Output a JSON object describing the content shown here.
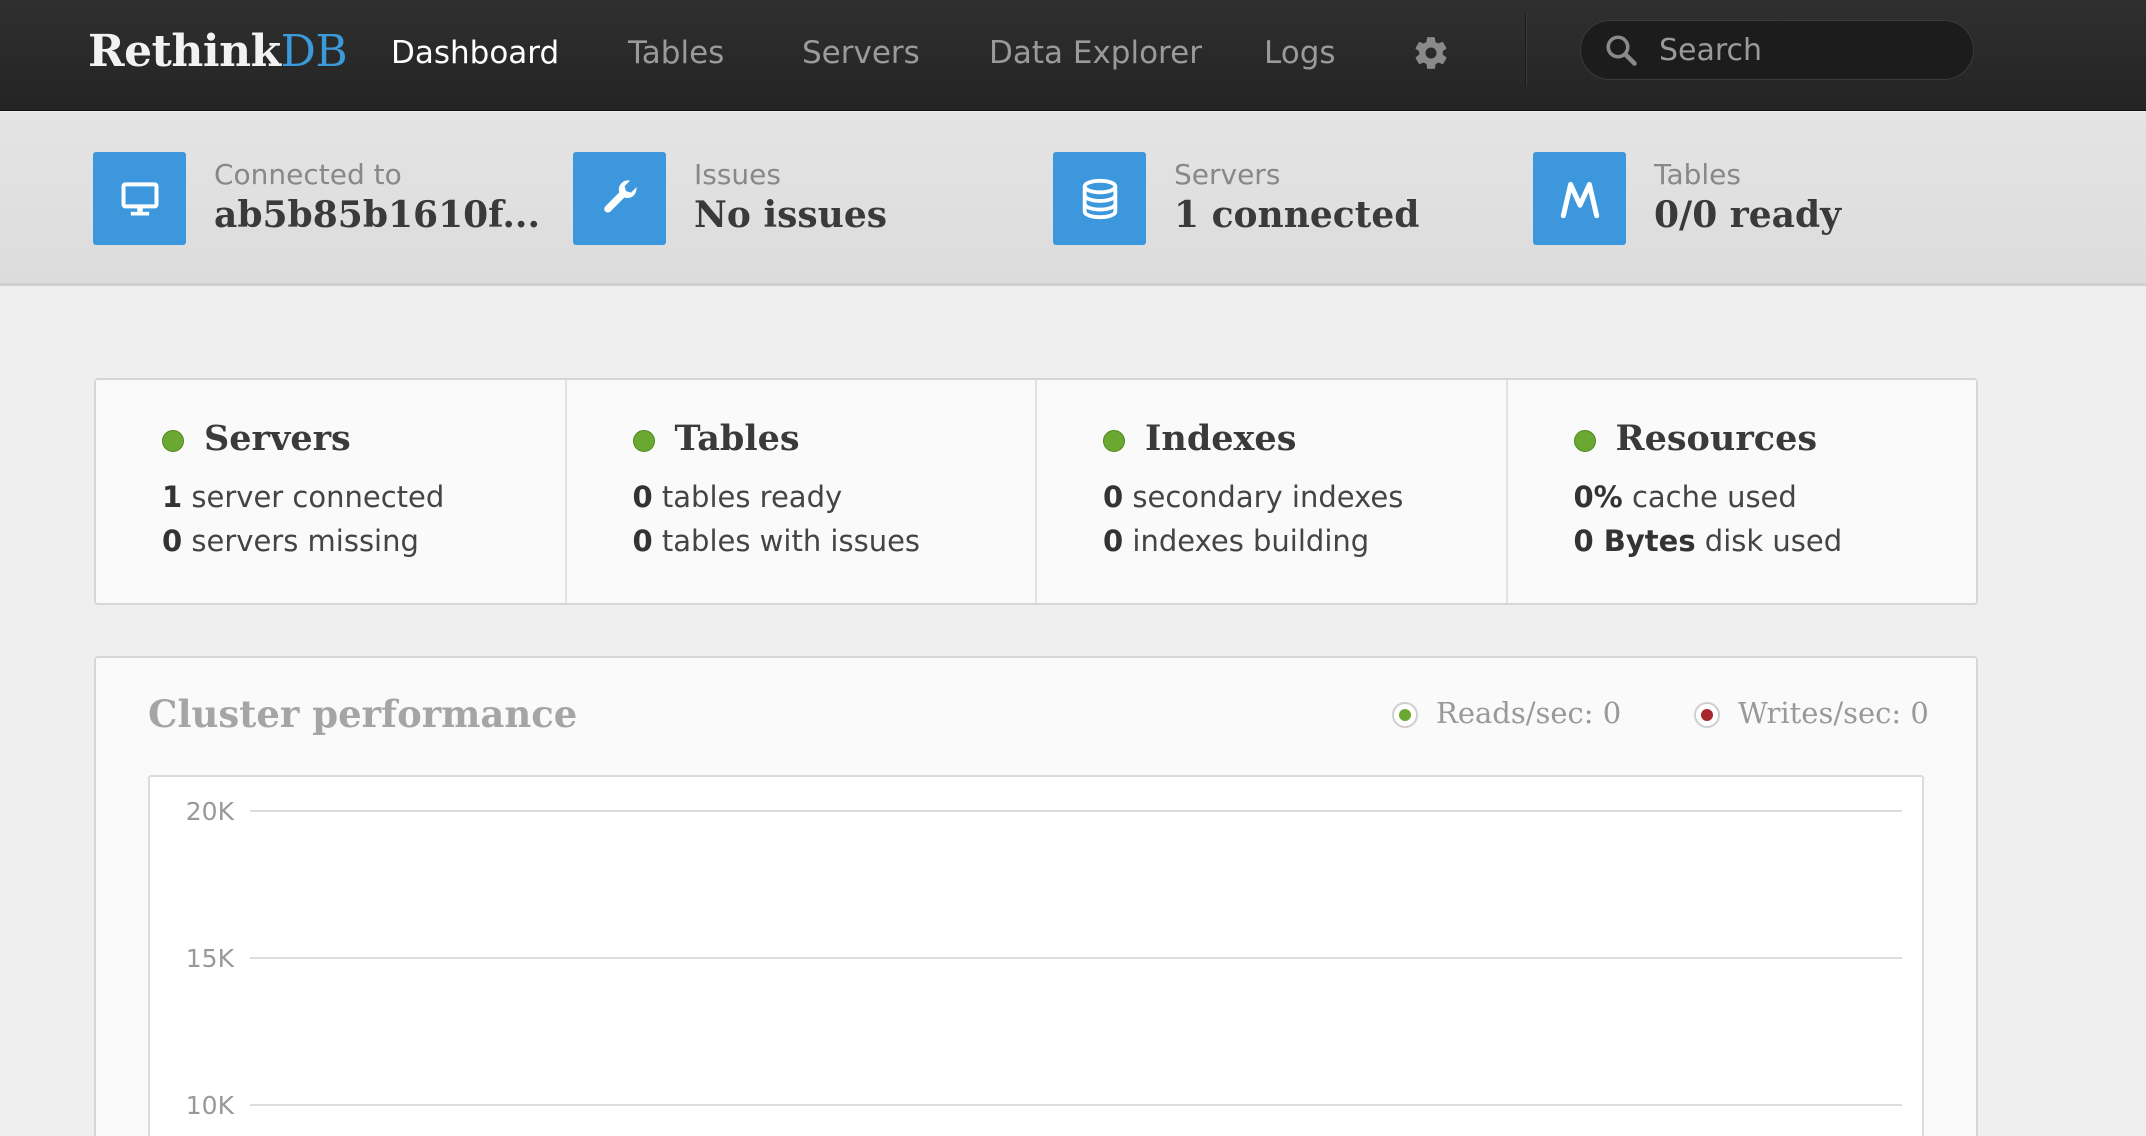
{
  "navbar": {
    "brand_main": "Rethink",
    "brand_accent": "DB",
    "items": [
      {
        "label": "Dashboard",
        "active": true
      },
      {
        "label": "Tables",
        "active": false
      },
      {
        "label": "Servers",
        "active": false
      },
      {
        "label": "Data Explorer",
        "active": false
      },
      {
        "label": "Logs",
        "active": false
      }
    ],
    "settings_icon": "gear-icon",
    "search": {
      "placeholder": "Search",
      "value": "",
      "icon": "search-icon"
    }
  },
  "status": [
    {
      "icon": "monitor-icon",
      "label": "Connected to",
      "value": "ab5b85b1610f..."
    },
    {
      "icon": "wrench-icon",
      "label": "Issues",
      "value": "No issues"
    },
    {
      "icon": "database-icon",
      "label": "Servers",
      "value": "1 connected"
    },
    {
      "icon": "tables-logo-icon",
      "label": "Tables",
      "value": "0/0 ready"
    }
  ],
  "summary": [
    {
      "title": "Servers",
      "lines": [
        {
          "num": "1",
          "text": " server connected"
        },
        {
          "num": "0",
          "text": " servers missing"
        }
      ]
    },
    {
      "title": "Tables",
      "lines": [
        {
          "num": "0",
          "text": " tables ready"
        },
        {
          "num": "0",
          "text": " tables with issues"
        }
      ]
    },
    {
      "title": "Indexes",
      "lines": [
        {
          "num": "0",
          "text": " secondary indexes"
        },
        {
          "num": "0",
          "text": " indexes building"
        }
      ]
    },
    {
      "title": "Resources",
      "lines": [
        {
          "num": "0%",
          "text": " cache used"
        },
        {
          "num": "0 Bytes",
          "text": " disk used"
        }
      ]
    }
  ],
  "performance": {
    "title": "Cluster performance",
    "legend": [
      {
        "label": "Reads/sec: 0",
        "color": "#6aa832"
      },
      {
        "label": "Writes/sec: 0",
        "color": "#a8272a"
      }
    ]
  },
  "colors": {
    "accent": "#3c97dc",
    "ok": "#6aa832",
    "reads": "#6aa832",
    "writes": "#a8272a"
  },
  "chart_data": {
    "type": "line",
    "title": "Cluster performance",
    "y_ticks": [
      "20K",
      "15K",
      "10K"
    ],
    "series": [
      {
        "name": "Reads/sec",
        "values": [
          0
        ]
      },
      {
        "name": "Writes/sec",
        "values": [
          0
        ]
      }
    ],
    "grid": true
  }
}
